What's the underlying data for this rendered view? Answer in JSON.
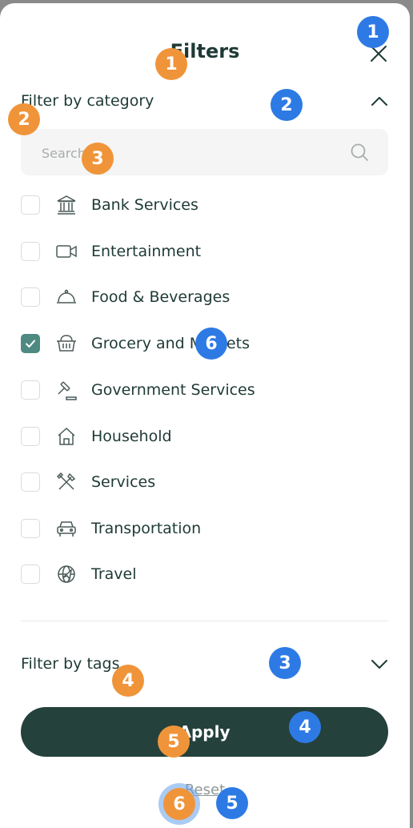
{
  "header": {
    "title": "Filters"
  },
  "category": {
    "label": "Filter by category",
    "search_placeholder": "Search",
    "items": [
      {
        "label": "Bank Services",
        "icon": "bank-icon",
        "checked": false
      },
      {
        "label": "Entertainment",
        "icon": "video-camera-icon",
        "checked": false
      },
      {
        "label": "Food & Beverages",
        "icon": "food-cloche-icon",
        "checked": false
      },
      {
        "label": "Grocery and Markets",
        "icon": "basket-icon",
        "checked": true
      },
      {
        "label": "Government Services",
        "icon": "gavel-icon",
        "checked": false
      },
      {
        "label": "Household",
        "icon": "house-icon",
        "checked": false
      },
      {
        "label": "Services",
        "icon": "tools-icon",
        "checked": false
      },
      {
        "label": "Transportation",
        "icon": "car-icon",
        "checked": false
      },
      {
        "label": "Travel",
        "icon": "globe-plane-icon",
        "checked": false
      }
    ]
  },
  "tags": {
    "label": "Filter by tags"
  },
  "actions": {
    "apply_label": "Apply",
    "reset_label": "Reset"
  },
  "badges": {
    "blue": [
      "1",
      "2",
      "3",
      "4",
      "5",
      "6"
    ],
    "orange": [
      "1",
      "2",
      "3",
      "4",
      "5",
      "6"
    ]
  },
  "colors": {
    "primary": "#24413c",
    "accent_checked": "#4f8a82",
    "badge_blue": "#2d7ae5",
    "badge_orange": "#f0943a"
  }
}
